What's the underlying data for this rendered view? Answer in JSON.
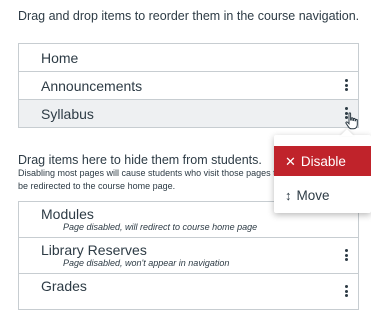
{
  "instructions": "Drag and drop items to reorder them in the course navigation.",
  "enabled_items": [
    {
      "label": "Home"
    },
    {
      "label": "Announcements"
    },
    {
      "label": "Syllabus"
    }
  ],
  "hidden_section": {
    "heading": "Drag items here to hide them from students.",
    "note": "Disabling most pages will cause students who visit those pages to be redirected to the course home page."
  },
  "disabled_items": [
    {
      "label": "Modules",
      "status": "Page disabled, will redirect to course home page"
    },
    {
      "label": "Library Reserves",
      "status": "Page disabled, won't appear in navigation"
    },
    {
      "label": "Grades",
      "status": ""
    }
  ],
  "context_menu": {
    "disable_label": "Disable",
    "disable_icon": "close-icon",
    "move_label": "Move",
    "move_icon": "updown-arrow-icon"
  },
  "colors": {
    "disable_bg": "#c0232b",
    "text": "#2d3b45",
    "border": "#c7cdd1"
  }
}
